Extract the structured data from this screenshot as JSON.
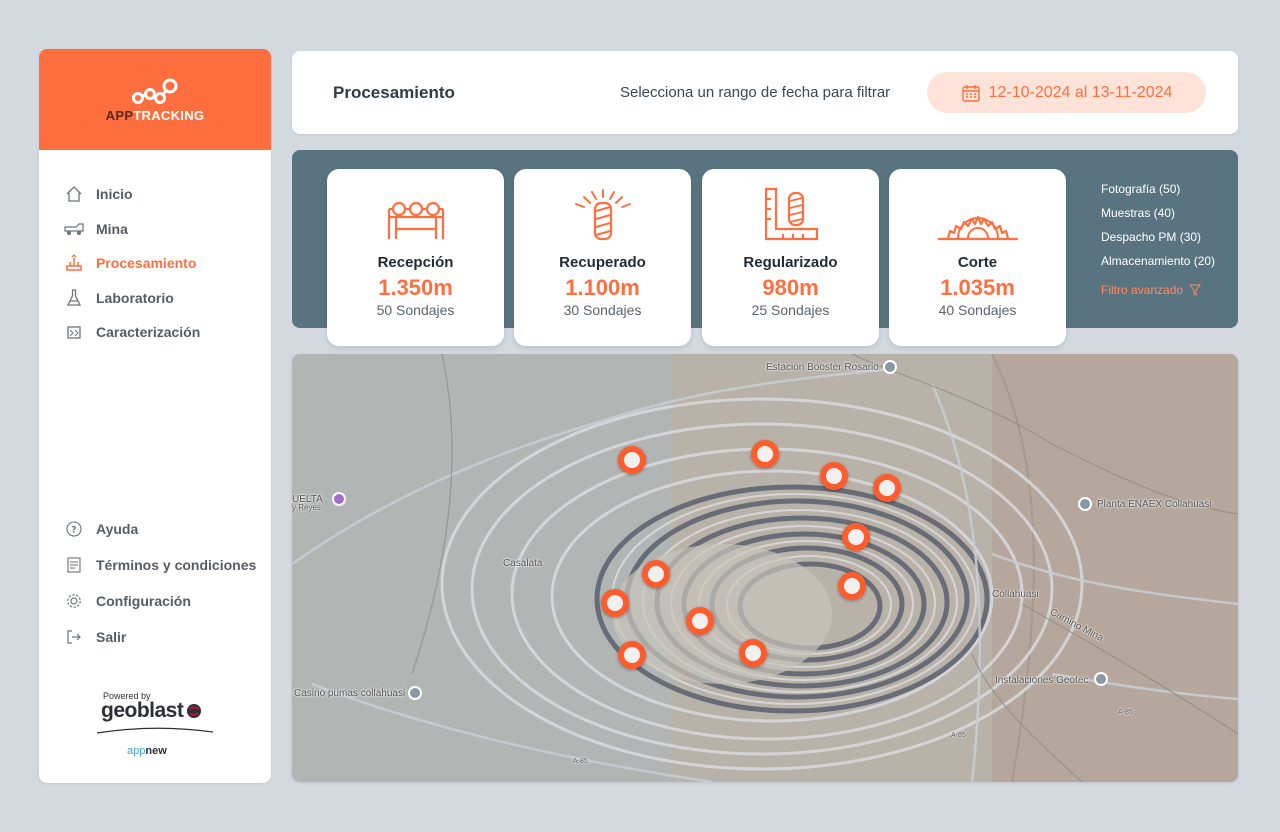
{
  "app": {
    "logo_part1": "APP",
    "logo_part2": "TRACKING"
  },
  "sidebar": {
    "items": [
      {
        "label": "Inicio",
        "icon": "home-icon"
      },
      {
        "label": "Mina",
        "icon": "mine-truck-icon"
      },
      {
        "label": "Procesamiento",
        "icon": "processing-icon",
        "active": true
      },
      {
        "label": "Laboratorio",
        "icon": "flask-icon"
      },
      {
        "label": "Caracterización",
        "icon": "characterization-icon"
      }
    ],
    "bottom_items": [
      {
        "label": "Ayuda",
        "icon": "help-icon"
      },
      {
        "label": "Términos y condiciones",
        "icon": "document-icon"
      },
      {
        "label": "Configuración",
        "icon": "gear-icon"
      },
      {
        "label": "Salir",
        "icon": "logout-icon"
      }
    ],
    "powered_by": "Powered by",
    "geoblast": "geoblast",
    "appnew_a": "app",
    "appnew_b": "new"
  },
  "header": {
    "title": "Procesamiento",
    "filter_label": "Selecciona un rango de fecha para filtrar",
    "date_range": "12-10-2024 al 13-11-2024"
  },
  "stats": [
    {
      "name": "Recepción",
      "value": "1.350m",
      "sub": "50 Sondajes"
    },
    {
      "name": "Recuperado",
      "value": "1.100m",
      "sub": "30 Sondajes"
    },
    {
      "name": "Regularizado",
      "value": "980m",
      "sub": "25 Sondajes"
    },
    {
      "name": "Corte",
      "value": "1.035m",
      "sub": "40 Sondajes"
    }
  ],
  "filters": {
    "items": [
      "Fotografía (50)",
      "Muestras (40)",
      "Despacho PM (30)",
      "Almacenamiento (20)"
    ],
    "advanced": "Filtro avanzado"
  },
  "map": {
    "labels": [
      "Estación Booster Rosario",
      "Planta ENAEX Collahuasi",
      "Casalata",
      "Collahuasi",
      "Casino pumas collahuasi",
      "Instalaciones Geotec",
      "Camino Mina",
      "A-85",
      "A-85",
      "A-85",
      "UELTA",
      "y Reyes"
    ]
  },
  "colors": {
    "accent": "#ff6e3f",
    "panel": "#597480",
    "background": "#d3d9df"
  }
}
